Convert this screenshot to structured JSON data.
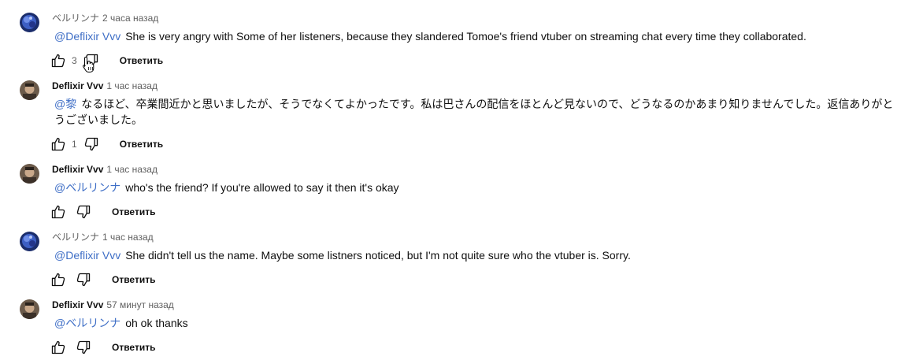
{
  "comments": [
    {
      "author": "ベルリンナ",
      "time": "2 часа назад",
      "mention": "@Deflixir Vvv",
      "text": "She is very angry with Some of her listeners, because they slandered Tomoe's friend vtuber on streaming chat every time they collaborated.",
      "likes": "3",
      "reply_label": "Ответить",
      "avatar": "blue-anime-avatar"
    },
    {
      "author": "Deflixir Vvv",
      "time": "1 час назад",
      "mention": "@黎",
      "text": "なるほど、卒業間近かと思いましたが、そうでなくてよかったです。私は巴さんの配信をほとんど見ないので、どうなるのかあまり知りませんでした。返信ありがとうございました。",
      "likes": "1",
      "reply_label": "Ответить",
      "avatar": "brown-avatar"
    },
    {
      "author": "Deflixir Vvv",
      "time": "1 час назад",
      "mention": "@ベルリンナ",
      "text": "who's the friend? If you're allowed to say it then it's okay",
      "likes": "",
      "reply_label": "Ответить",
      "avatar": "brown-avatar"
    },
    {
      "author": "ベルリンナ",
      "time": "1 час назад",
      "mention": "@Deflixir Vvv",
      "text": "She didn't tell us the name. Maybe some listners noticed, but I'm not quite sure who the vtuber is. Sorry.",
      "likes": "",
      "reply_label": "Ответить",
      "avatar": "blue-anime-avatar"
    },
    {
      "author": "Deflixir Vvv",
      "time": "57 минут назад",
      "mention": "@ベルリンナ",
      "text": "oh ok thanks",
      "likes": "",
      "reply_label": "Ответить",
      "avatar": "brown-avatar"
    }
  ],
  "icons": {
    "like": "thumbs-up-icon",
    "dislike": "thumbs-down-icon",
    "cursor": "hand-pointer-icon"
  }
}
